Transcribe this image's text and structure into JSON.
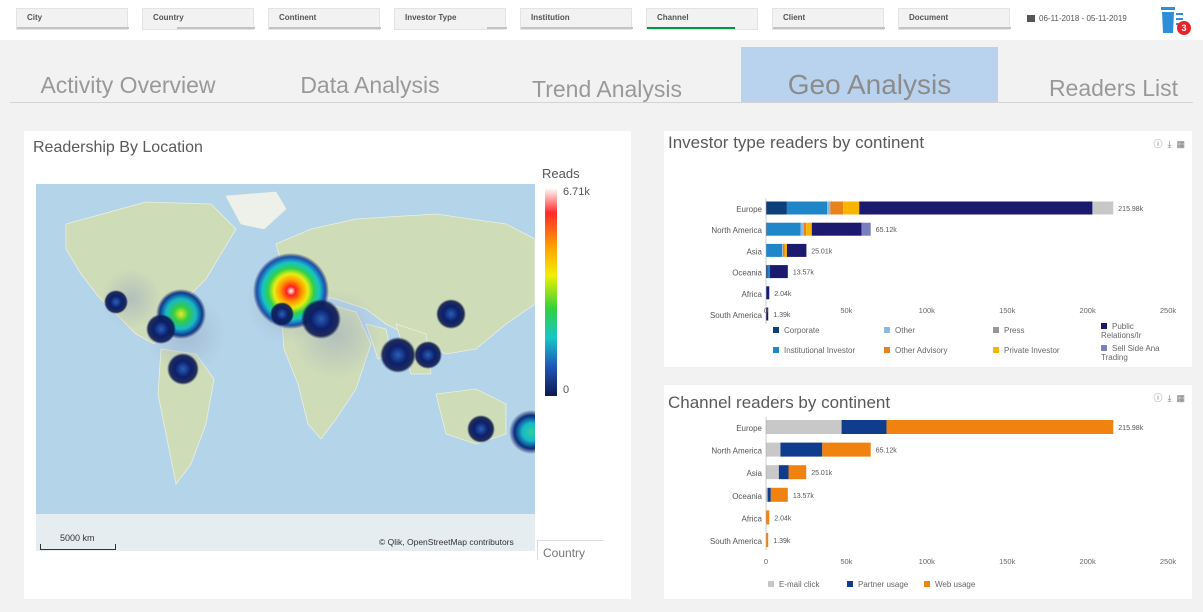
{
  "filters": [
    {
      "label": "City",
      "active": false
    },
    {
      "label": "Country",
      "active": false
    },
    {
      "label": "Continent",
      "active": false
    },
    {
      "label": "Investor Type",
      "active": false
    },
    {
      "label": "Institution",
      "active": false
    },
    {
      "label": "Channel",
      "active": true
    },
    {
      "label": "Client",
      "active": false
    },
    {
      "label": "Document",
      "active": false
    }
  ],
  "date_range": "06-11-2018 - 05-11-2019",
  "selections_badge": "3",
  "tabs": [
    {
      "label": "Activity Overview",
      "active": false
    },
    {
      "label": "Data Analysis",
      "active": false
    },
    {
      "label": "Trend Analysis",
      "active": false
    },
    {
      "label": "Geo Analysis",
      "active": true
    },
    {
      "label": "Readers List",
      "active": false
    }
  ],
  "map_panel": {
    "title": "Readership By Location",
    "legend_title": "Reads",
    "legend_max": "6.71k",
    "legend_min": "0",
    "scale_label": "5000 km",
    "attribution": "© Qlik, OpenStreetMap contributors",
    "dimension_label": "Country"
  },
  "chart_data": [
    {
      "type": "bar",
      "orientation": "horizontal",
      "stacked": true,
      "title": "Investor type readers by continent",
      "categories": [
        "Europe",
        "North America",
        "Asia",
        "Oceania",
        "Africa",
        "South America"
      ],
      "totals_labels": [
        "215.98k",
        "65.12k",
        "25.01k",
        "13.57k",
        "2.04k",
        "1.39k"
      ],
      "totals": [
        215980,
        65120,
        25010,
        13570,
        2040,
        1390
      ],
      "x_ticks": [
        "0",
        "50k",
        "100k",
        "150k",
        "200k",
        "250k"
      ],
      "xlim": [
        0,
        250000
      ],
      "series": [
        {
          "name": "Corporate",
          "color": "#0d3f7a",
          "values": [
            13000,
            500,
            0,
            1000,
            0,
            0
          ]
        },
        {
          "name": "Institutional Investor",
          "color": "#1f86c8",
          "values": [
            25000,
            21000,
            10000,
            1500,
            200,
            0
          ]
        },
        {
          "name": "Other",
          "color": "#8fb8e0",
          "values": [
            2000,
            2000,
            500,
            0,
            0,
            0
          ]
        },
        {
          "name": "Other Advisory",
          "color": "#e8821b",
          "values": [
            8000,
            1500,
            1000,
            0,
            0,
            0
          ]
        },
        {
          "name": "Private Investor",
          "color": "#f7b500",
          "values": [
            10000,
            3500,
            1500,
            0,
            0,
            0
          ]
        },
        {
          "name": "Public Relations/Ir",
          "color": "#1c1a6e",
          "values": [
            145000,
            31000,
            12000,
            11070,
            1840,
            1390
          ]
        },
        {
          "name": "Press",
          "color": "#c8c8c8",
          "values": [
            12980,
            0,
            0,
            0,
            0,
            0
          ]
        },
        {
          "name": "Sell Side Analyst Trading",
          "color": "#7a7fc0",
          "values": [
            0,
            5620,
            10,
            0,
            0,
            0
          ]
        }
      ],
      "legend": [
        {
          "name": "Corporate",
          "color": "#0d3f7a"
        },
        {
          "name": "Other",
          "color": "#8fb8e0"
        },
        {
          "name": "Press",
          "color": "#999999"
        },
        {
          "name": "Public Relations/Ir",
          "color": "#1c1a6e"
        },
        {
          "name": "Institutional Investor",
          "color": "#1f86c8"
        },
        {
          "name": "Other Advisory",
          "color": "#e8821b"
        },
        {
          "name": "Private Investor",
          "color": "#f7b500"
        },
        {
          "name": "Sell Side Ana Trading",
          "color": "#7a7fc0"
        }
      ]
    },
    {
      "type": "bar",
      "orientation": "horizontal",
      "stacked": true,
      "title": "Channel readers by continent",
      "categories": [
        "Europe",
        "North America",
        "Asia",
        "Oceania",
        "Africa",
        "South America"
      ],
      "totals_labels": [
        "215.98k",
        "65.12k",
        "25.01k",
        "13.57k",
        "2.04k",
        "1.39k"
      ],
      "totals": [
        215980,
        65120,
        25010,
        13570,
        2040,
        1390
      ],
      "x_ticks": [
        "0",
        "50k",
        "100k",
        "150k",
        "200k",
        "250k"
      ],
      "xlim": [
        0,
        250000
      ],
      "series": [
        {
          "name": "E-mail click",
          "color": "#c8c8c8",
          "values": [
            47000,
            9000,
            8000,
            1000,
            0,
            0
          ]
        },
        {
          "name": "Partner usage",
          "color": "#0f3c8c",
          "values": [
            28000,
            26000,
            6000,
            2000,
            0,
            0
          ]
        },
        {
          "name": "Web usage",
          "color": "#f0820f",
          "values": [
            140980,
            30120,
            11010,
            10570,
            2040,
            1390
          ]
        }
      ],
      "legend": [
        {
          "name": "E-mail click",
          "color": "#c8c8c8"
        },
        {
          "name": "Partner usage",
          "color": "#0f3c8c"
        },
        {
          "name": "Web usage",
          "color": "#f0820f"
        }
      ]
    }
  ],
  "icons": {
    "info": "info-icon",
    "download": "download-icon",
    "image": "image-export-icon",
    "trash": "clear-selections-icon"
  }
}
